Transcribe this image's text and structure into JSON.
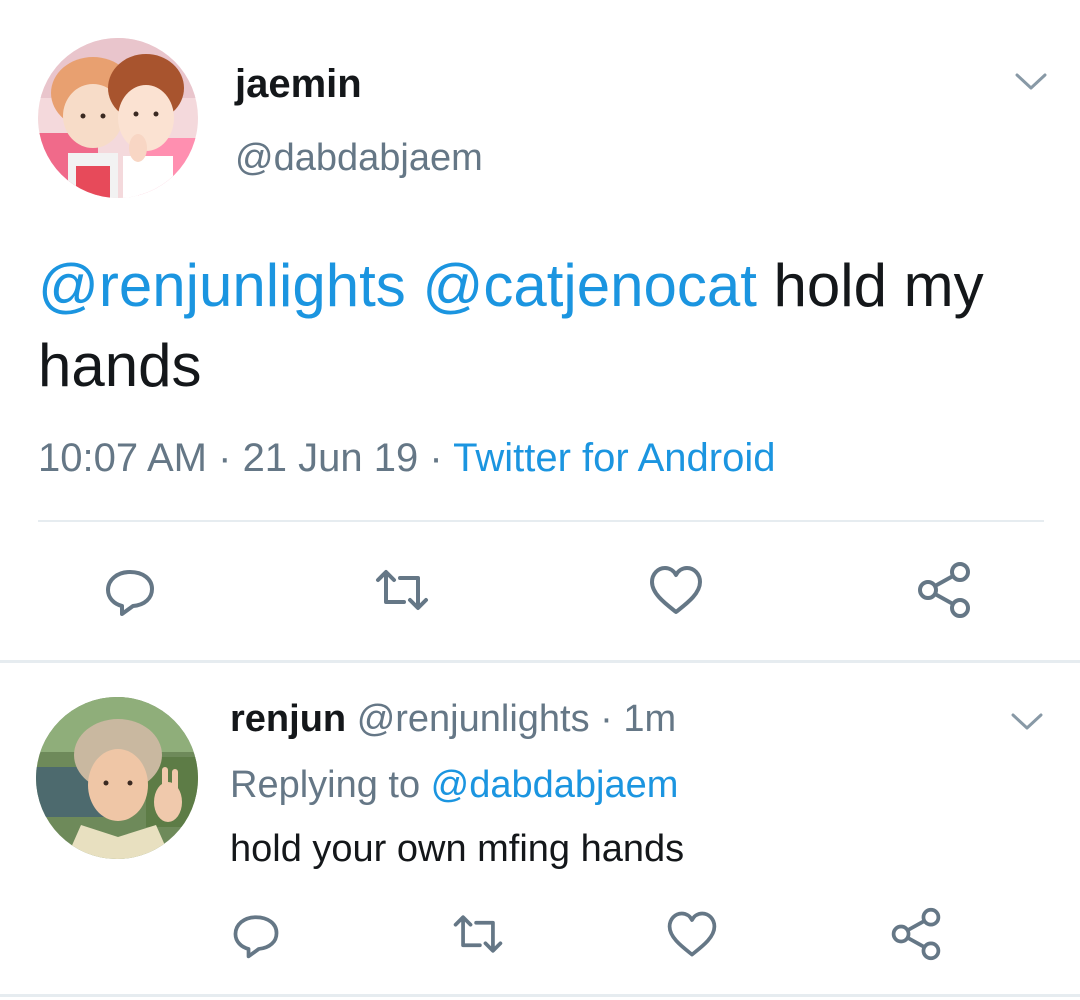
{
  "main_tweet": {
    "name": "jaemin",
    "handle": "@dabdabjaem",
    "mention_1": "@renjunlights",
    "mention_2": "@catjenocat",
    "text": " hold my hands",
    "time": "10:07 AM",
    "sep_1": " · ",
    "date": "21 Jun 19",
    "sep_2": " · ",
    "source": "Twitter for Android",
    "actions": [
      "reply-icon",
      "retweet-icon",
      "like-icon",
      "share-icon"
    ]
  },
  "reply_tweet": {
    "name": "renjun",
    "handle": "@renjunlights",
    "sep": " · ",
    "age": "1m",
    "replying_prefix": "Replying to ",
    "replying_to": "@dabdabjaem",
    "text": "hold your own mfing hands",
    "actions": [
      "reply-icon",
      "retweet-icon",
      "like-icon",
      "share-icon"
    ]
  },
  "colors": {
    "link": "#1b95e0",
    "secondary_text": "#657786",
    "primary_text": "#14171a",
    "divider": "#e6ecf0",
    "icon": "#657786"
  }
}
